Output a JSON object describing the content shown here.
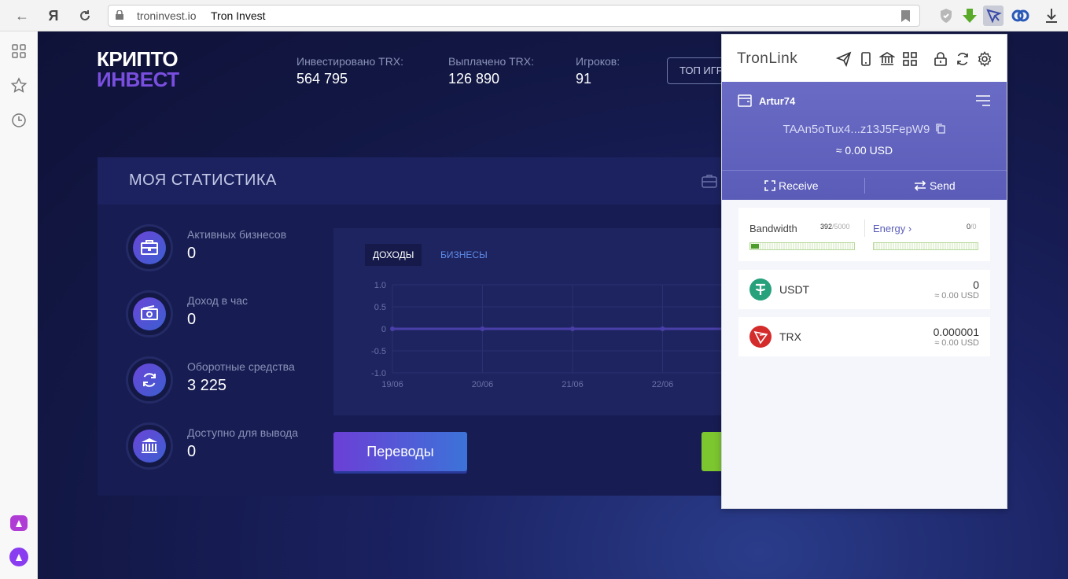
{
  "browser": {
    "brand": "Я",
    "url_domain": "troninvest.io",
    "page_title": "Tron Invest"
  },
  "site": {
    "logo_line1": "КРИПТО",
    "logo_line2": "ИНВЕСТ",
    "header_stats": [
      {
        "label": "Инвестировано TRX:",
        "value": "564 795"
      },
      {
        "label": "Выплачено TRX:",
        "value": "126 890"
      },
      {
        "label": "Игроков:",
        "value": "91"
      }
    ],
    "top_button": "ТОП ИГРОКОВ",
    "panel_title": "МОЯ СТАТИСТИКА",
    "stats": [
      {
        "label": "Активных бизнесов",
        "value": "0",
        "icon": "briefcase-icon"
      },
      {
        "label": "Доход в час",
        "value": "0",
        "icon": "money-icon"
      },
      {
        "label": "Оборотные средства",
        "value": "3 225",
        "icon": "refresh-icon"
      },
      {
        "label": "Доступно для вывода",
        "value": "0",
        "icon": "bank-icon"
      }
    ],
    "chart_tabs": {
      "active": "ДОХОДЫ",
      "inactive": "БИЗНЕСЫ"
    },
    "transfers_button": "Переводы"
  },
  "chart_data": {
    "type": "line",
    "categories": [
      "19/06",
      "20/06",
      "21/06",
      "22/06"
    ],
    "series": [
      {
        "values": [
          0,
          0,
          0,
          0
        ]
      }
    ],
    "y_ticks": [
      "1.0",
      "0.5",
      "0",
      "-0.5",
      "-1.0"
    ],
    "ylim": [
      -1.0,
      1.0
    ],
    "grid": true
  },
  "tronlink": {
    "logo": "TronLink",
    "account_name": "Artur74",
    "address": "TAAn5oTux4...z13J5FepW9",
    "balance_usd": "≈ 0.00 USD",
    "receive_label": "Receive",
    "send_label": "Send",
    "bandwidth": {
      "label": "Bandwidth",
      "used": "392",
      "total": "/5000",
      "fraction": 0.0784
    },
    "energy": {
      "label": "Energy",
      "arrow": "›",
      "used": "0",
      "total": "/0"
    },
    "tokens": [
      {
        "name": "USDT",
        "amount": "0",
        "usd": "≈ 0.00 USD",
        "color": "#26a17b"
      },
      {
        "name": "TRX",
        "amount": "0.000001",
        "usd": "≈ 0.00 USD",
        "color": "#d42b2b"
      }
    ]
  }
}
